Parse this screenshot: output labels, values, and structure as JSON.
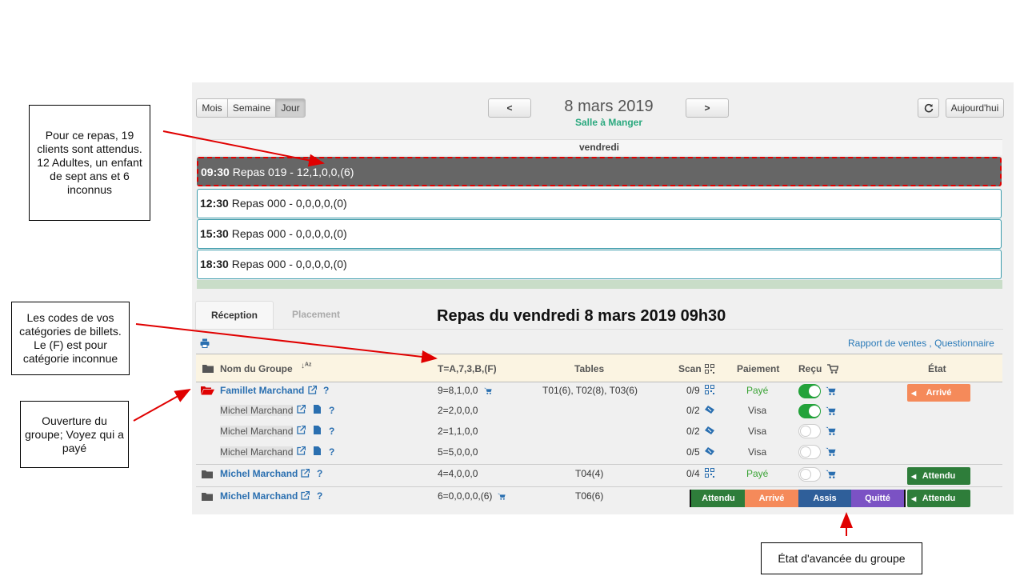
{
  "calendar": {
    "view_buttons": [
      "Mois",
      "Semaine",
      "Jour"
    ],
    "prev_label": "<",
    "next_label": ">",
    "date_title": "8 mars 2019",
    "subtitle": "Salle à Manger",
    "today_label": "Aujourd'hui",
    "day_header": "vendredi",
    "slots": [
      {
        "time": "09:30",
        "text": "Repas 019 - 12,1,0,0,(6)"
      },
      {
        "time": "12:30",
        "text": "Repas 000 - 0,0,0,0,(0)"
      },
      {
        "time": "15:30",
        "text": "Repas 000 - 0,0,0,0,(0)"
      },
      {
        "time": "18:30",
        "text": "Repas 000 - 0,0,0,0,(0)"
      }
    ]
  },
  "tabs": [
    "Réception",
    "Placement"
  ],
  "repas_title": "Repas du vendredi 8 mars 2019 09h30",
  "links": "Rapport de ventes , Questionnaire",
  "table": {
    "headers": {
      "group": "Nom du Groupe",
      "codes": "T=A,7,3,B,(F)",
      "tables": "Tables",
      "scan": "Scan",
      "payment": "Paiement",
      "received": "Reçu",
      "state": "État"
    },
    "rows": [
      {
        "name": "Famillet Marchand",
        "codes": "9=8,1,0,0",
        "tables": "T01(6), T02(8), T03(6)",
        "scan": "0/9",
        "payment": "Payé",
        "state": "Arrivé"
      },
      {
        "name": "Michel Marchand",
        "codes": "2=2,0,0,0",
        "tables": "",
        "scan": "0/2",
        "payment": "Visa"
      },
      {
        "name": "Michel Marchand",
        "codes": "2=1,1,0,0",
        "tables": "",
        "scan": "0/2",
        "payment": "Visa"
      },
      {
        "name": "Michel Marchand",
        "codes": "5=5,0,0,0",
        "tables": "",
        "scan": "0/5",
        "payment": "Visa"
      },
      {
        "name": "Michel Marchand",
        "codes": "4=4,0,0,0",
        "tables": "T04(4)",
        "scan": "0/4",
        "payment": "Payé",
        "state": "Attendu"
      },
      {
        "name": "Michel Marchand",
        "codes": "6=0,0,0,0,(6)",
        "tables": "T06(6)",
        "state": "Attendu"
      }
    ],
    "progress_buttons": [
      "Attendu",
      "Arrivé",
      "Assis",
      "Quitté"
    ]
  },
  "annotations": {
    "repas": "Pour ce repas, 19 clients sont attendus. 12 Adultes, un enfant de sept ans et 6 inconnus",
    "codes": "Les codes de vos catégories de billets. Le (F) est pour catégorie inconnue",
    "ouverture": "Ouverture du groupe; Voyez qui a payé",
    "etat": "État d'avancée du groupe"
  },
  "colors": {
    "accent_green": "#2aa87e",
    "link_blue": "#2a6fb0",
    "arrive_orange": "#f58a5a",
    "attendu_green": "#2e7d3a",
    "assis_blue": "#2f5f9a",
    "quitte_purple": "#7b52c4",
    "annotation_red": "#e00000"
  }
}
